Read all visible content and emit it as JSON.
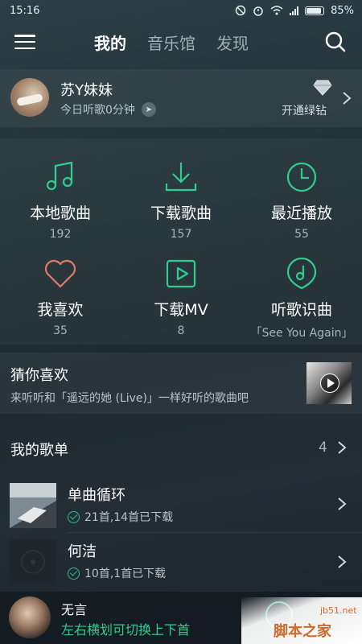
{
  "status_bar": {
    "time": "15:16",
    "battery": "85%"
  },
  "nav": {
    "tabs": [
      {
        "label": "我的",
        "active": true
      },
      {
        "label": "音乐馆",
        "active": false
      },
      {
        "label": "发现",
        "active": false
      }
    ]
  },
  "profile": {
    "name": "苏Y妹妹",
    "listen_time": "今日听歌0分钟",
    "vip_label": "开通绿钻"
  },
  "grid": [
    {
      "label": "本地歌曲",
      "count": "192",
      "icon": "music-note-icon"
    },
    {
      "label": "下载歌曲",
      "count": "157",
      "icon": "download-icon"
    },
    {
      "label": "最近播放",
      "count": "55",
      "icon": "clock-icon"
    },
    {
      "label": "我喜欢",
      "count": "35",
      "icon": "heart-icon"
    },
    {
      "label": "下载MV",
      "count": "8",
      "icon": "video-play-icon"
    },
    {
      "label": "听歌识曲",
      "count": "「See You Again」",
      "icon": "music-recognize-icon"
    }
  ],
  "guess": {
    "title": "猜你喜欢",
    "subtitle": "来听听和「遥远的她 (Live)」一样好听的歌曲吧"
  },
  "playlists": {
    "title": "我的歌单",
    "count": "4",
    "items": [
      {
        "name": "单曲循环",
        "meta": "21首,14首已下载"
      },
      {
        "name": "何洁",
        "meta": "10首,1首已下载"
      }
    ]
  },
  "player": {
    "title": "无言",
    "hint": "左右横划可切换上下首"
  },
  "watermark": {
    "url": "jb51.net",
    "text": "脚本之家"
  },
  "colors": {
    "accent": "#2fce8f",
    "heart": "#e07a6a",
    "background": "#223238"
  }
}
